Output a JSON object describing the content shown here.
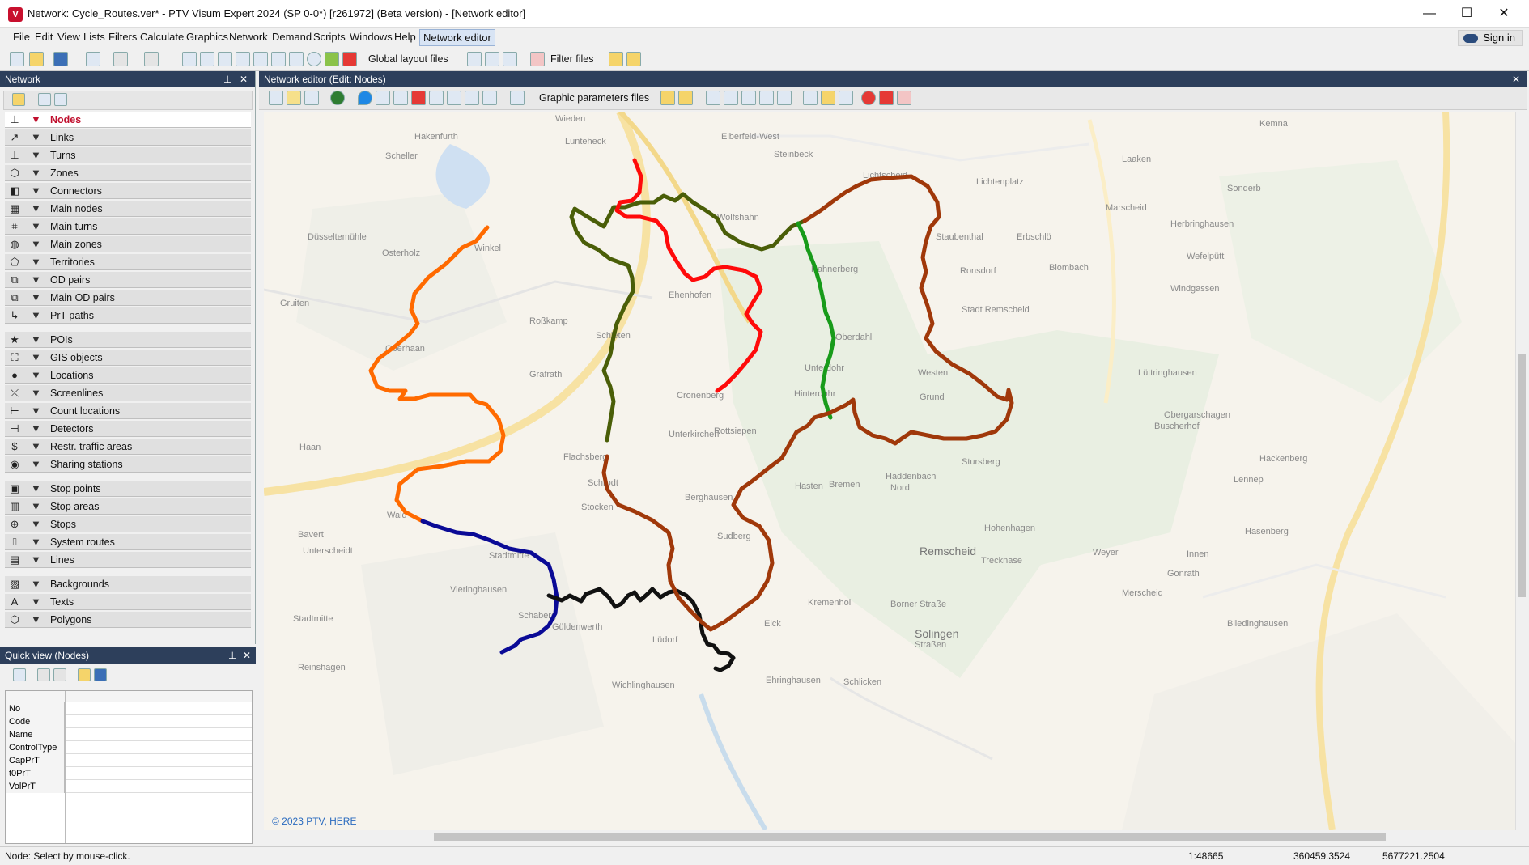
{
  "window": {
    "title": "Network: Cycle_Routes.ver* - PTV Visum Expert 2024 (SP 0-0*) [r261972] (Beta version) - [Network editor]",
    "minimize": "—",
    "maximize": "☐",
    "close": "✕"
  },
  "menu": {
    "items": [
      "File",
      "Edit",
      "View",
      "Lists",
      "Filters",
      "Calculate",
      "Graphics",
      "Network",
      "Demand",
      "Scripts",
      "Windows",
      "Help",
      "Network editor"
    ],
    "signin": "Sign in"
  },
  "toolbar": {
    "global_layout": "Global layout files",
    "filter_files": "Filter files"
  },
  "network_panel": {
    "title": "Network",
    "pin": "⊥",
    "close": "✕",
    "groups": [
      [
        {
          "label": "Nodes",
          "icon": "node-icon",
          "glyph": "⊥",
          "selected": true
        },
        {
          "label": "Links",
          "icon": "link-icon",
          "glyph": "↗"
        },
        {
          "label": "Turns",
          "icon": "turn-icon",
          "glyph": "⊥"
        },
        {
          "label": "Zones",
          "icon": "zone-icon",
          "glyph": "⬡"
        },
        {
          "label": "Connectors",
          "icon": "connector-icon",
          "glyph": "◧"
        },
        {
          "label": "Main nodes",
          "icon": "main-node-icon",
          "glyph": "▦"
        },
        {
          "label": "Main turns",
          "icon": "main-turn-icon",
          "glyph": "⌗"
        },
        {
          "label": "Main zones",
          "icon": "main-zone-icon",
          "glyph": "◍"
        },
        {
          "label": "Territories",
          "icon": "territory-icon",
          "glyph": "⬠"
        },
        {
          "label": "OD pairs",
          "icon": "od-pair-icon",
          "glyph": "⧉"
        },
        {
          "label": "Main OD pairs",
          "icon": "main-od-pair-icon",
          "glyph": "⧉"
        },
        {
          "label": "PrT paths",
          "icon": "prt-path-icon",
          "glyph": "↳"
        }
      ],
      [
        {
          "label": "POIs",
          "icon": "poi-icon",
          "glyph": "★"
        },
        {
          "label": "GIS objects",
          "icon": "gis-object-icon",
          "glyph": "⛶"
        },
        {
          "label": "Locations",
          "icon": "location-icon",
          "glyph": "●"
        },
        {
          "label": "Screenlines",
          "icon": "screenline-icon",
          "glyph": "⤫"
        },
        {
          "label": "Count locations",
          "icon": "count-location-icon",
          "glyph": "⊢"
        },
        {
          "label": "Detectors",
          "icon": "detector-icon",
          "glyph": "⊣"
        },
        {
          "label": "Restr. traffic areas",
          "icon": "restricted-area-icon",
          "glyph": "$"
        },
        {
          "label": "Sharing stations",
          "icon": "sharing-station-icon",
          "glyph": "◉"
        }
      ],
      [
        {
          "label": "Stop points",
          "icon": "stop-point-icon",
          "glyph": "▣"
        },
        {
          "label": "Stop areas",
          "icon": "stop-area-icon",
          "glyph": "▥"
        },
        {
          "label": "Stops",
          "icon": "stop-icon",
          "glyph": "⊕"
        },
        {
          "label": "System routes",
          "icon": "system-route-icon",
          "glyph": "⎍"
        },
        {
          "label": "Lines",
          "icon": "line-icon",
          "glyph": "▤"
        }
      ],
      [
        {
          "label": "Backgrounds",
          "icon": "background-icon",
          "glyph": "▨"
        },
        {
          "label": "Texts",
          "icon": "text-icon",
          "glyph": "A"
        },
        {
          "label": "Polygons",
          "icon": "polygon-icon",
          "glyph": "⬡"
        }
      ]
    ]
  },
  "quick_view": {
    "title": "Quick view (Nodes)",
    "attributes": [
      "No",
      "Code",
      "Name",
      "ControlType",
      "CapPrT",
      "t0PrT",
      "VolPrT"
    ]
  },
  "editor": {
    "title": "Network editor (Edit: Nodes)",
    "graphic_params": "Graphic parameters files",
    "copyright": "© 2023 PTV, HERE"
  },
  "map_labels": [
    "Wieden",
    "Lunteheck",
    "Elberfeld-West",
    "Hakenfurth",
    "Scheller",
    "Steinbeck",
    "Lichtscheid",
    "Lichtenplatz",
    "Wolfshahn",
    "Düsseltemühle",
    "Osterholz",
    "Winkel",
    "Laaken",
    "Marscheid",
    "Sonderb",
    "Herbringhausen",
    "Erbschlö",
    "Blombach",
    "Staubenthal",
    "Wefelpütt",
    "Ronsdorf",
    "Windgassen",
    "Kemna",
    "Stadt Remscheid",
    "Ehenhofen",
    "Hahnerberg",
    "Gruiten",
    "Roßkamp",
    "Schieten",
    "Oberdahl",
    "Oberhaan",
    "Grafrath",
    "Unterdohr",
    "Westen",
    "Lüttringhausen",
    "Cronenberg",
    "Grund",
    "Obergarschagen",
    "Buscherhof",
    "Hinterdohr",
    "Haan",
    "Unterkirchen",
    "Rottsiepen",
    "Haddenbach",
    "Nord",
    "Stursberg",
    "Hackenberg",
    "Flachsberg",
    "Hasten",
    "Bremen",
    "Lennep",
    "Schrodt",
    "Berghausen",
    "Wald",
    "Stocken",
    "Hohenhagen",
    "Hasenberg",
    "Bavert",
    "Sudberg",
    "Remscheid",
    "Weyer",
    "Unterscheidt",
    "Stadtmitte",
    "Trecknase",
    "Innen",
    "Gonrath",
    "Vieringhausen",
    "Kremenholl",
    "Borner Straße",
    "Merscheid",
    "Stadtmitte",
    "Solingen",
    "Schaberg",
    "Güldenwerth",
    "Eick",
    "Lüdorf",
    "Bliedinghausen",
    "Straßen",
    "Reinshagen",
    "Ehringhausen",
    "Schlicken",
    "Wichlinghausen"
  ],
  "status": {
    "message": "Node: Select by mouse-click.",
    "scale": "1:48665",
    "x": "360459.3524",
    "y": "5677221.2504"
  },
  "route_colors": {
    "orange": "#ff6a00",
    "brown": "#a0380a",
    "olive": "#4a5e08",
    "red": "#ff0a0a",
    "green": "#189b1a",
    "navy": "#0a0a96",
    "black": "#111111"
  }
}
